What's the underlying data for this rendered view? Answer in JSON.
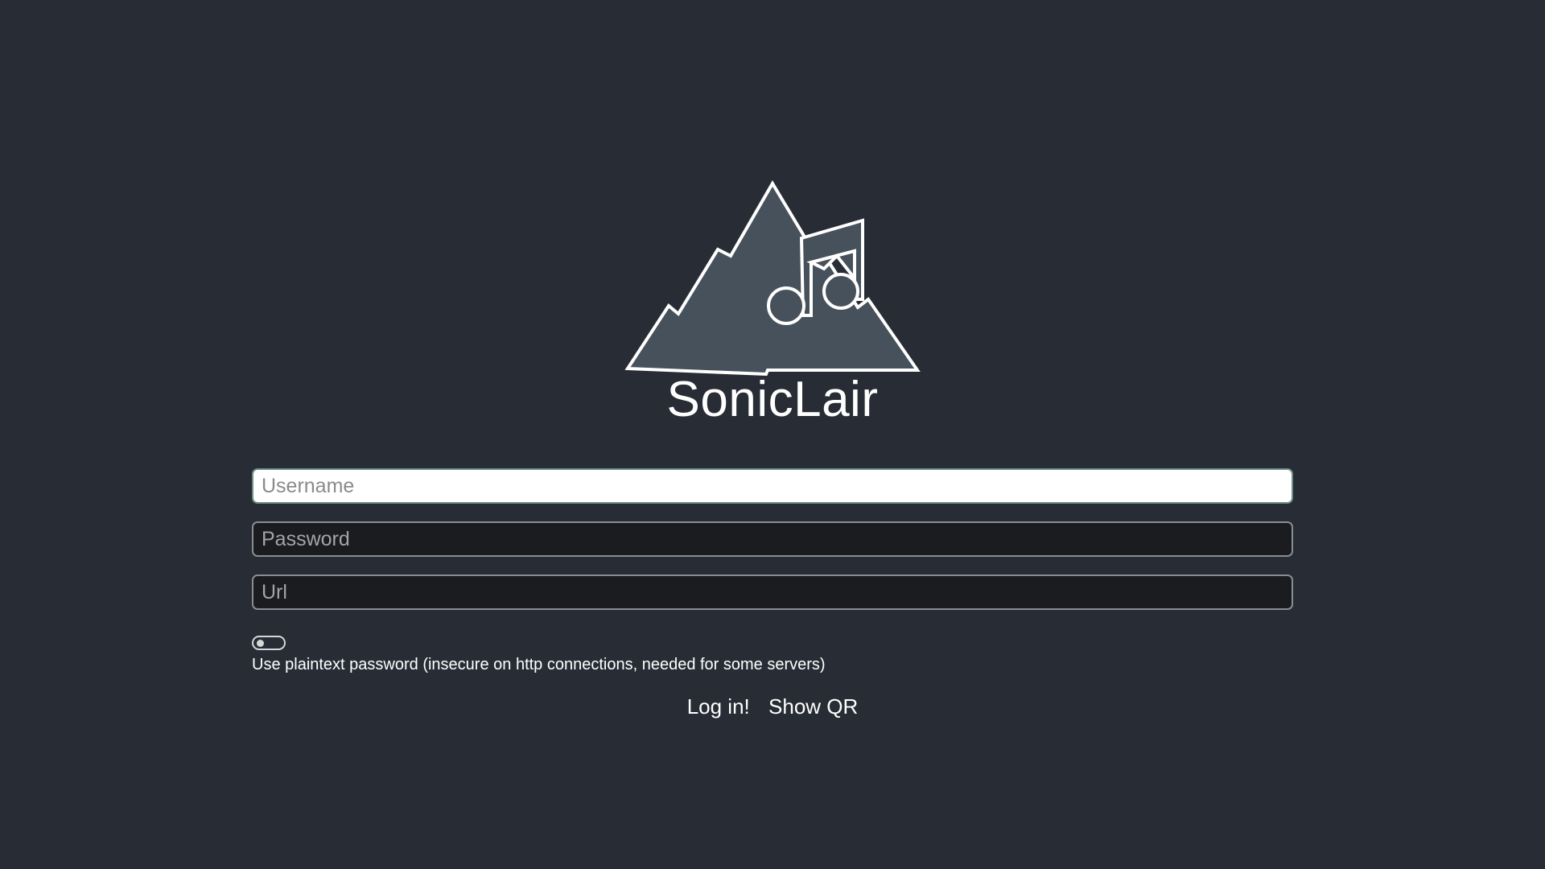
{
  "app": {
    "name": "SonicLair"
  },
  "form": {
    "username_placeholder": "Username",
    "password_placeholder": "Password",
    "url_placeholder": "Url",
    "plaintext_toggle": {
      "on": false,
      "label": "Use plaintext password (insecure on http connections, needed for some servers)"
    }
  },
  "actions": {
    "login_label": "Log in!",
    "show_qr_label": "Show QR"
  },
  "colors": {
    "background": "#282c35",
    "logo_fill": "#47515b",
    "logo_stroke": "#ffffff",
    "field_background": "#1b1c20",
    "field_focused_background": "#ffffff"
  },
  "icons": {
    "logo": "mountain-music-note-logo"
  }
}
